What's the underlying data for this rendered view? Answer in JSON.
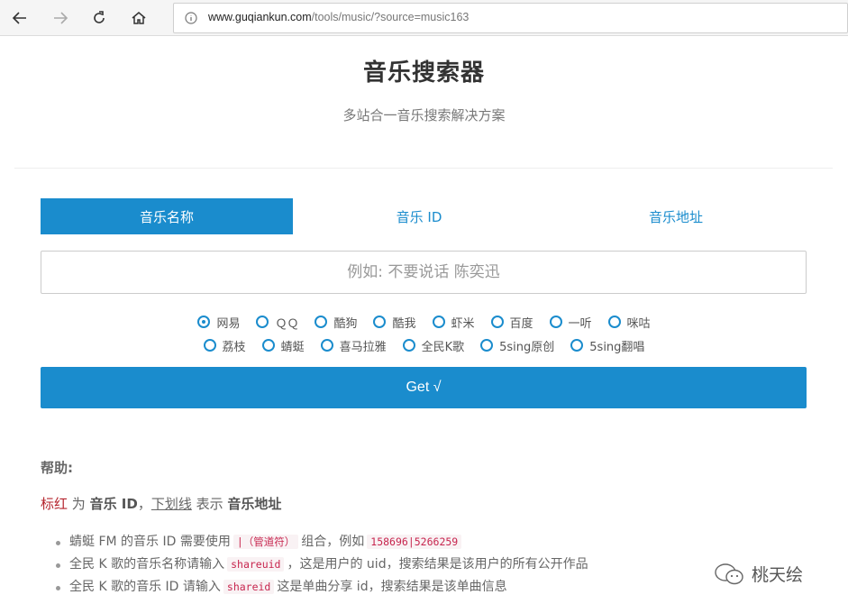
{
  "browser": {
    "url_host": "www.guqiankun.com",
    "url_path": "/tools/music/?source=music163"
  },
  "header": {
    "title": "音乐搜索器",
    "subtitle": "多站合一音乐搜索解决方案"
  },
  "tabs": [
    {
      "label": "音乐名称",
      "active": true
    },
    {
      "label": "音乐 ID",
      "active": false
    },
    {
      "label": "音乐地址",
      "active": false
    }
  ],
  "search": {
    "placeholder": "例如: 不要说话 陈奕迅",
    "value": ""
  },
  "sources_row1": [
    {
      "label": "网易",
      "checked": true
    },
    {
      "label": "ＱＱ",
      "checked": false
    },
    {
      "label": "酷狗",
      "checked": false
    },
    {
      "label": "酷我",
      "checked": false
    },
    {
      "label": "虾米",
      "checked": false
    },
    {
      "label": "百度",
      "checked": false
    },
    {
      "label": "一听",
      "checked": false
    },
    {
      "label": "咪咕",
      "checked": false
    }
  ],
  "sources_row2": [
    {
      "label": "荔枝",
      "checked": false
    },
    {
      "label": "蜻蜓",
      "checked": false
    },
    {
      "label": "喜马拉雅",
      "checked": false
    },
    {
      "label": "全民K歌",
      "checked": false
    },
    {
      "label": "5sing原创",
      "checked": false
    },
    {
      "label": "5sing翻唱",
      "checked": false
    }
  ],
  "get_button": "Get √",
  "help": {
    "title": "帮助:",
    "legend": {
      "red_word": "标红",
      "for1": " 为 ",
      "music_id": "音乐 ID",
      "comma": "，",
      "underline_word": "下划线",
      "for2": " 表示 ",
      "music_url": "音乐地址"
    },
    "items": [
      {
        "pre": "蜻蜓 FM 的音乐 ID 需要使用",
        "code1": "|（管道符）",
        "mid": "组合，例如",
        "code2": "158696|5266259",
        "post": ""
      },
      {
        "pre": "全民 K 歌的音乐名称请输入",
        "code1": "shareuid",
        "mid": "，这是用户的 uid，搜索结果是该用户的所有公开作品",
        "code2": "",
        "post": ""
      },
      {
        "pre": "全民 K 歌的音乐 ID 请输入",
        "code1": "shareid",
        "mid": "这是单曲分享 id，搜索结果是该单曲信息",
        "code2": "",
        "post": ""
      }
    ]
  },
  "watermark": "桃天绘",
  "colors": {
    "accent": "#1a8ccd",
    "highlight_red": "#b5252e"
  }
}
